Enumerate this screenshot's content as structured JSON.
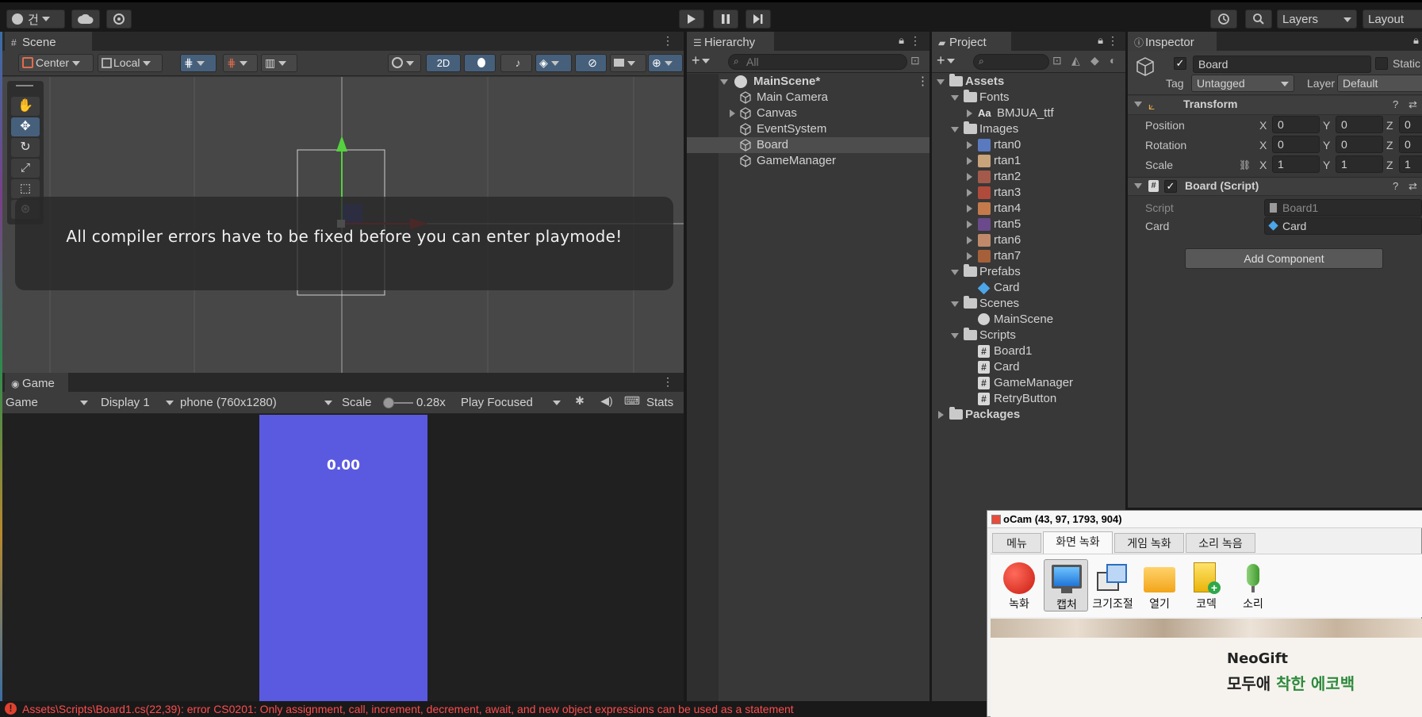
{
  "topbar": {
    "account_label": "건",
    "layers_label": "Layers",
    "layout_label": "Layout"
  },
  "scene": {
    "tab_label": "Scene",
    "pivot_label": "Center",
    "space_label": "Local",
    "mode_2d_label": "2D",
    "overlay_message": "All compiler errors have to be fixed before you can enter playmode!"
  },
  "game": {
    "tab_label": "Game",
    "view_dropdown": "Game",
    "display_dropdown": "Display 1",
    "resolution_dropdown": "phone (760x1280)",
    "scale_label": "Scale",
    "scale_value": "0.28x",
    "scale_fraction": 0.0,
    "play_mode_dropdown": "Play Focused",
    "stats_label": "Stats",
    "timer_text": "0.00"
  },
  "hierarchy": {
    "tab_label": "Hierarchy",
    "search_placeholder": "All",
    "scene_name": "MainScene*",
    "items": [
      {
        "label": "Main Camera",
        "expandable": false,
        "selected": false
      },
      {
        "label": "Canvas",
        "expandable": true,
        "selected": false
      },
      {
        "label": "EventSystem",
        "expandable": false,
        "selected": false
      },
      {
        "label": "Board",
        "expandable": false,
        "selected": true
      },
      {
        "label": "GameManager",
        "expandable": false,
        "selected": false
      }
    ]
  },
  "project": {
    "tab_label": "Project",
    "assets_label": "Assets",
    "fonts_label": "Fonts",
    "font_item_prefix": "Aa",
    "font_item": "BMJUA_ttf",
    "images_label": "Images",
    "images": [
      "rtan0",
      "rtan1",
      "rtan2",
      "rtan3",
      "rtan4",
      "rtan5",
      "rtan6",
      "rtan7"
    ],
    "prefabs_label": "Prefabs",
    "prefab_item": "Card",
    "scenes_label": "Scenes",
    "scene_item": "MainScene",
    "scripts_label": "Scripts",
    "scripts": [
      "Board1",
      "Card",
      "GameManager",
      "RetryButton"
    ],
    "packages_label": "Packages"
  },
  "inspector": {
    "tab_label": "Inspector",
    "object_name": "Board",
    "static_label": "Static",
    "tag_label": "Tag",
    "tag_value": "Untagged",
    "layer_label": "Layer",
    "layer_value": "Default",
    "transform_title": "Transform",
    "position_label": "Position",
    "rotation_label": "Rotation",
    "scale_label": "Scale",
    "axis_x": "X",
    "axis_y": "Y",
    "axis_z": "Z",
    "position": {
      "x": "0",
      "y": "0",
      "z": "0"
    },
    "rotation": {
      "x": "0",
      "y": "0",
      "z": "0"
    },
    "scale": {
      "x": "1",
      "y": "1",
      "z": "1"
    },
    "script_component_title": "Board (Script)",
    "script_label": "Script",
    "script_value": "Board1",
    "card_label": "Card",
    "card_value": "Card",
    "add_component_label": "Add Component"
  },
  "ocam": {
    "title": "oCam (43, 97, 1793, 904)",
    "tabs": [
      "메뉴",
      "화면 녹화",
      "게임 녹화",
      "소리 녹음"
    ],
    "buttons": [
      "녹화",
      "캡처",
      "크기조절",
      "열기",
      "코덱",
      "소리"
    ],
    "ad_brand": "NeoGift",
    "ad_text_prefix": "모두애 ",
    "ad_text_highlight": "착한 에코백"
  },
  "console": {
    "error_message": "Assets\\Scripts\\Board1.cs(22,39): error CS0201: Only assignment, call, increment, decrement, await, and new object expressions can be used as a statement"
  },
  "colors": {
    "accent_blue": "#46607c",
    "error_red": "#ff4d4d",
    "game_card": "#5a5ae1",
    "selection": "#4d4d4d"
  }
}
